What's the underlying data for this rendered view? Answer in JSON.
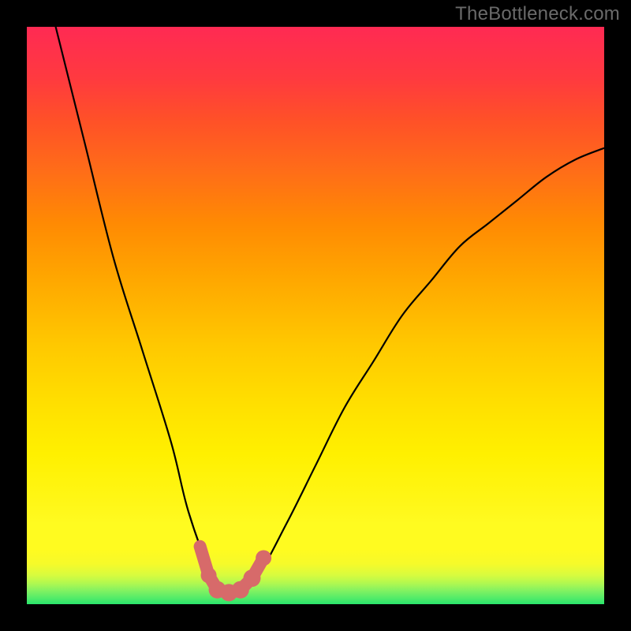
{
  "watermark": "TheBottleneck.com",
  "colors": {
    "frame": "#000000",
    "watermark_text": "#6a6a6a",
    "curve": "#000000",
    "marker_fill": "#d76a6a",
    "marker_stroke": "#b94f4f",
    "gradient_stops": [
      {
        "pos": 0.0,
        "color": "#2ae56c"
      },
      {
        "pos": 0.05,
        "color": "#d7fb3f"
      },
      {
        "pos": 0.1,
        "color": "#fffb20"
      },
      {
        "pos": 0.26,
        "color": "#fff000"
      },
      {
        "pos": 0.45,
        "color": "#ffc800"
      },
      {
        "pos": 0.66,
        "color": "#ff8a03"
      },
      {
        "pos": 0.84,
        "color": "#ff5028"
      },
      {
        "pos": 1.0,
        "color": "#ff2a53"
      }
    ]
  },
  "chart_data": {
    "type": "line",
    "title": "",
    "xlabel": "",
    "ylabel": "",
    "xlim": [
      0,
      100
    ],
    "ylim": [
      0,
      100
    ],
    "grid": false,
    "annotations": [],
    "series": [
      {
        "name": "bottleneck-curve",
        "x": [
          5,
          10,
          15,
          20,
          25,
          28,
          32,
          34,
          36,
          40,
          45,
          50,
          55,
          60,
          65,
          70,
          75,
          80,
          85,
          90,
          95,
          100
        ],
        "y": [
          100,
          80,
          60,
          44,
          28,
          16,
          5,
          2,
          2,
          5,
          14,
          24,
          34,
          42,
          50,
          56,
          62,
          66,
          70,
          74,
          77,
          79
        ]
      }
    ],
    "markers": {
      "name": "sweet-spot-markers",
      "points": [
        {
          "x": 30.0,
          "y": 10.0
        },
        {
          "x": 31.5,
          "y": 5.0
        },
        {
          "x": 33.0,
          "y": 2.5
        },
        {
          "x": 35.0,
          "y": 2.0
        },
        {
          "x": 37.0,
          "y": 2.5
        },
        {
          "x": 39.0,
          "y": 4.5
        },
        {
          "x": 41.0,
          "y": 8.0
        }
      ]
    }
  }
}
